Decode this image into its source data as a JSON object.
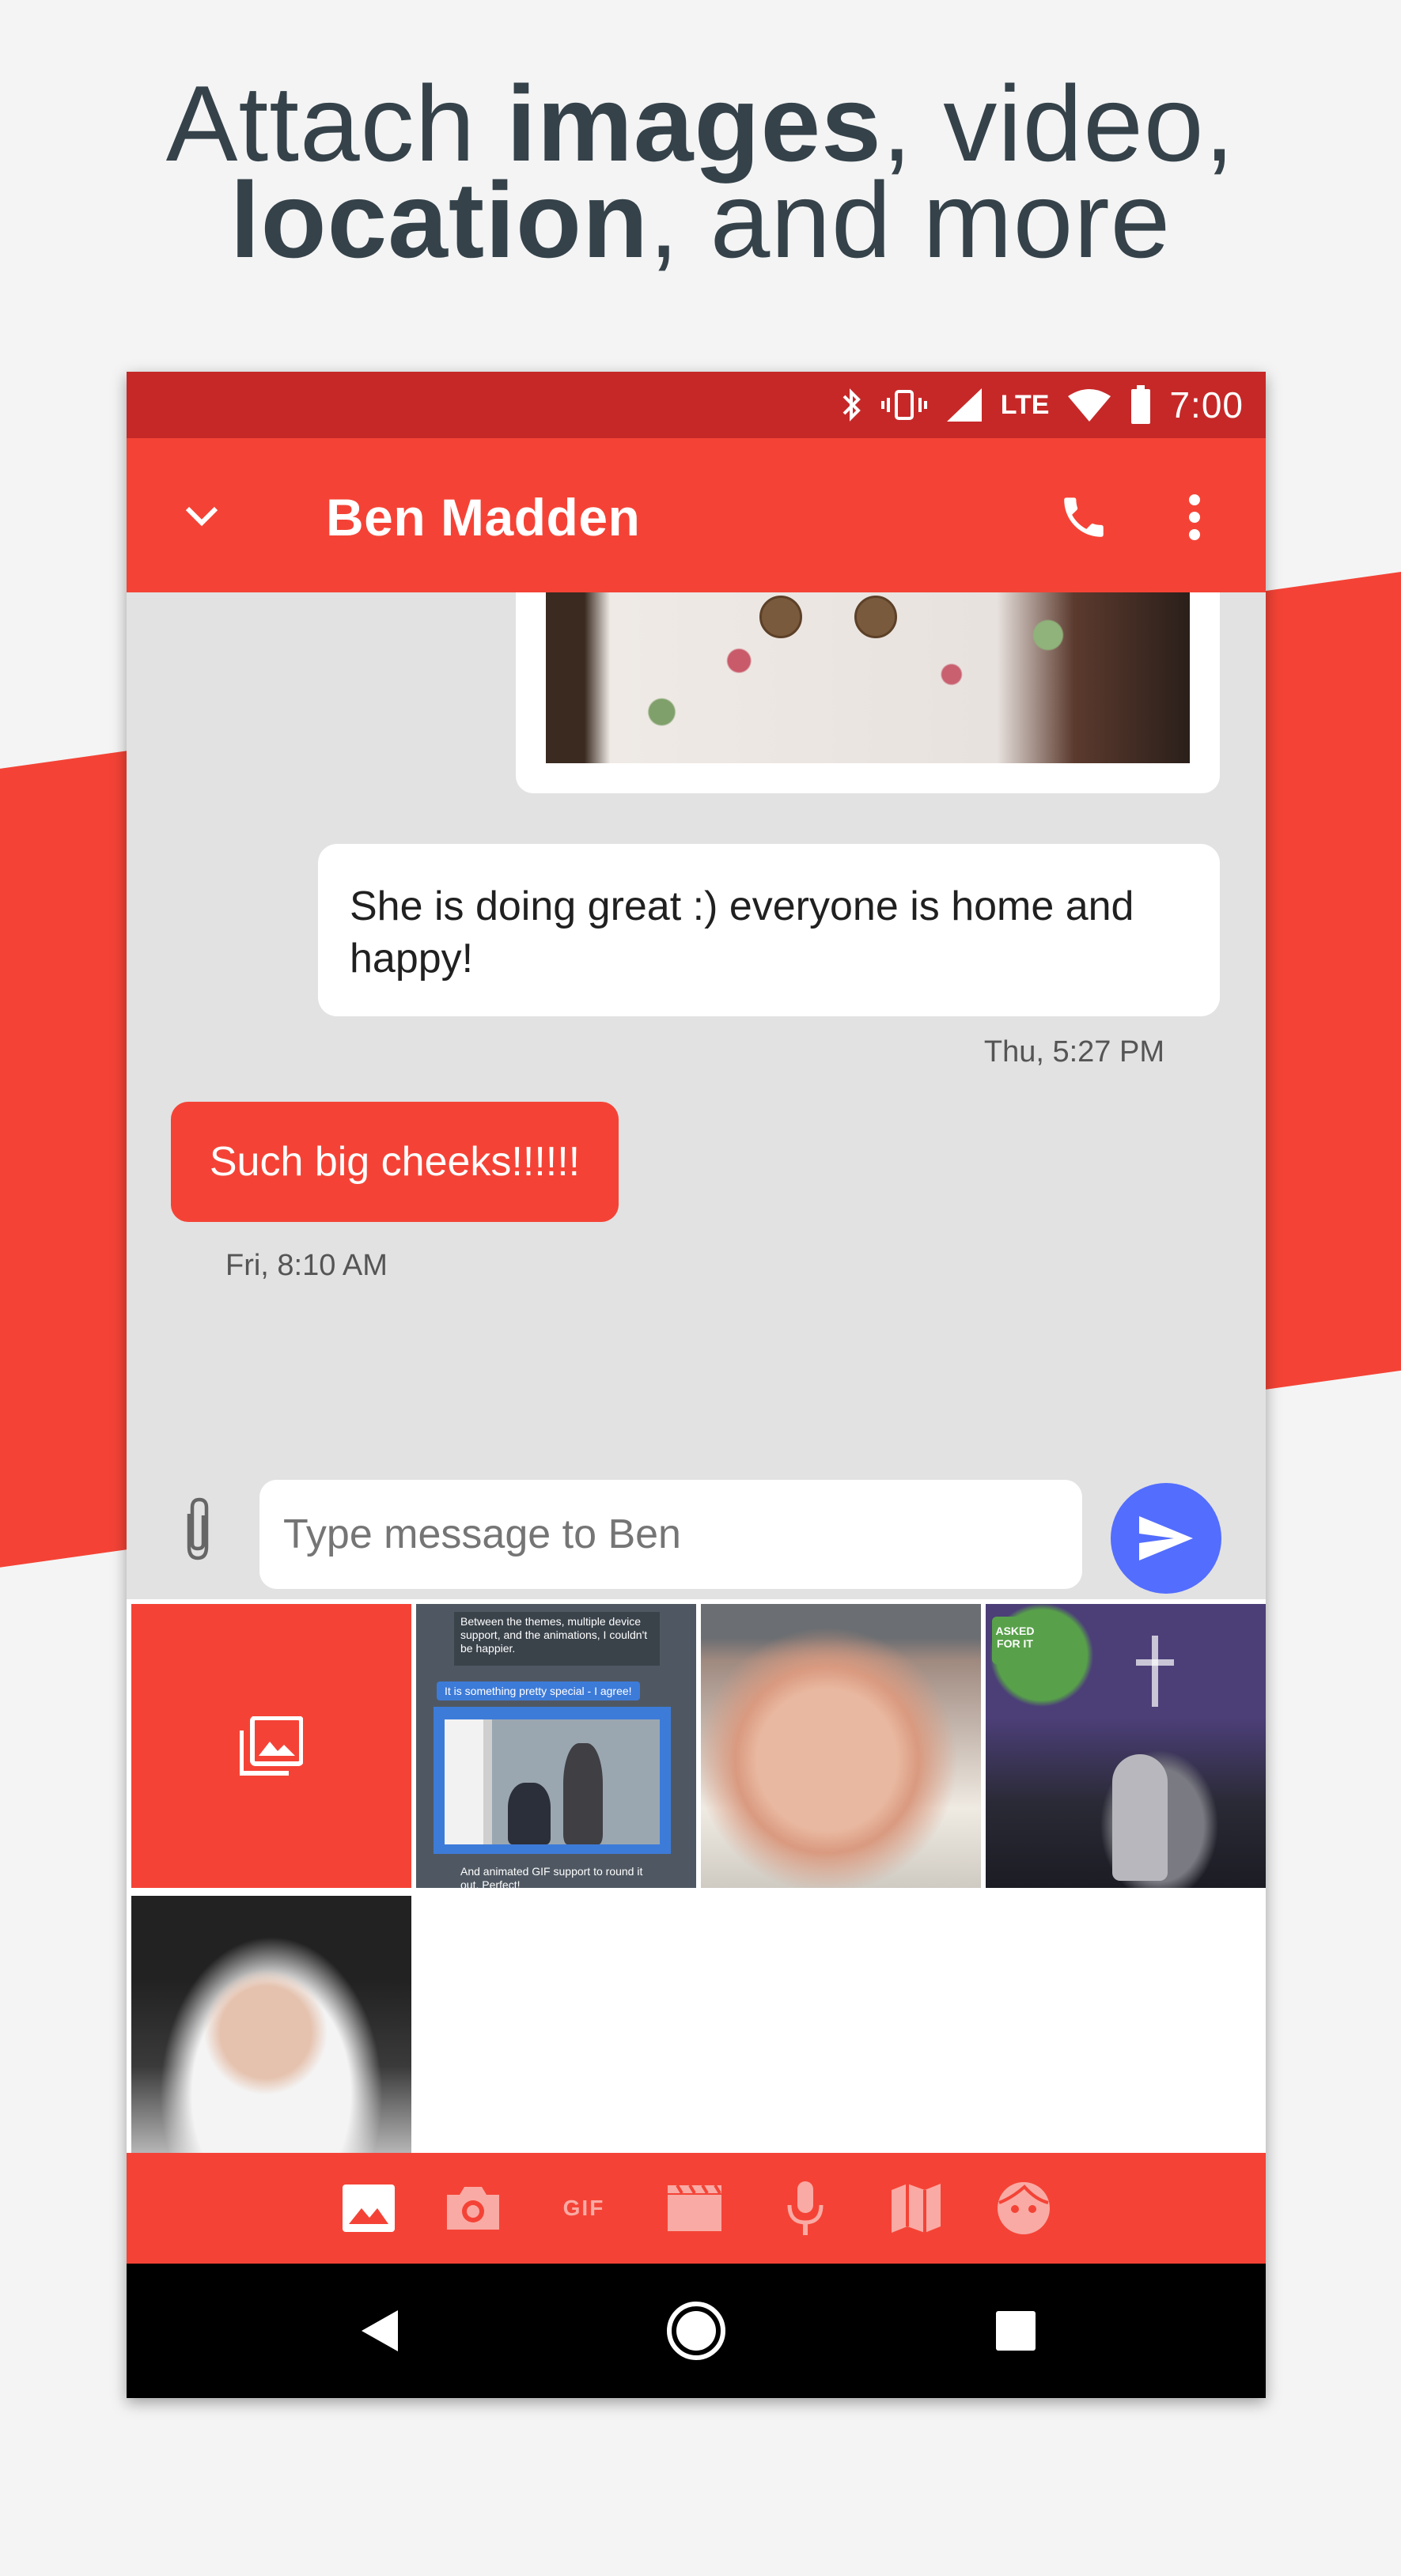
{
  "headline": {
    "line1_pre": "Attach ",
    "line1_bold": "images",
    "line1_post": ", video,",
    "line2_bold": "location",
    "line2_post": ", and more"
  },
  "status_bar": {
    "network": "LTE",
    "time": "7:00",
    "icons": [
      "bluetooth-icon",
      "vibrate-icon",
      "signal-icon",
      "wifi-icon",
      "battery-icon"
    ]
  },
  "app_bar": {
    "contact_name": "Ben Madden",
    "icons": [
      "chevron-down-icon",
      "phone-icon",
      "more-vert-icon"
    ]
  },
  "conversation": {
    "messages": [
      {
        "direction": "incoming",
        "type": "image"
      },
      {
        "direction": "incoming",
        "type": "text",
        "text": "She is doing great :) everyone is home and happy!",
        "timestamp": "Thu, 5:27 PM"
      },
      {
        "direction": "outgoing",
        "type": "text",
        "text": "Such big cheeks!!!!!!",
        "timestamp": "Fri, 8:10 AM"
      }
    ]
  },
  "composer": {
    "placeholder": "Type message to Ben",
    "icons": [
      "paperclip-icon",
      "send-icon"
    ]
  },
  "gallery": {
    "screenshot_text": {
      "top": "Between the themes, multiple device support, and the animations, I couldn't be happier.",
      "chip": "It is something pretty special - I agree!",
      "bottom": "And animated GIF support to round it out. Perfect!"
    },
    "church_sign": "ASKED FOR IT"
  },
  "attachment_toolbar": {
    "items": [
      "gallery-icon",
      "camera-icon",
      "gif-icon",
      "video-icon",
      "microphone-icon",
      "map-icon",
      "sticker-icon"
    ],
    "gif_label": "GIF"
  },
  "colors": {
    "primary": "#f44336",
    "primary_dark": "#c62828",
    "send_button": "#536dfe",
    "conversation_bg": "#e2e2e2"
  }
}
